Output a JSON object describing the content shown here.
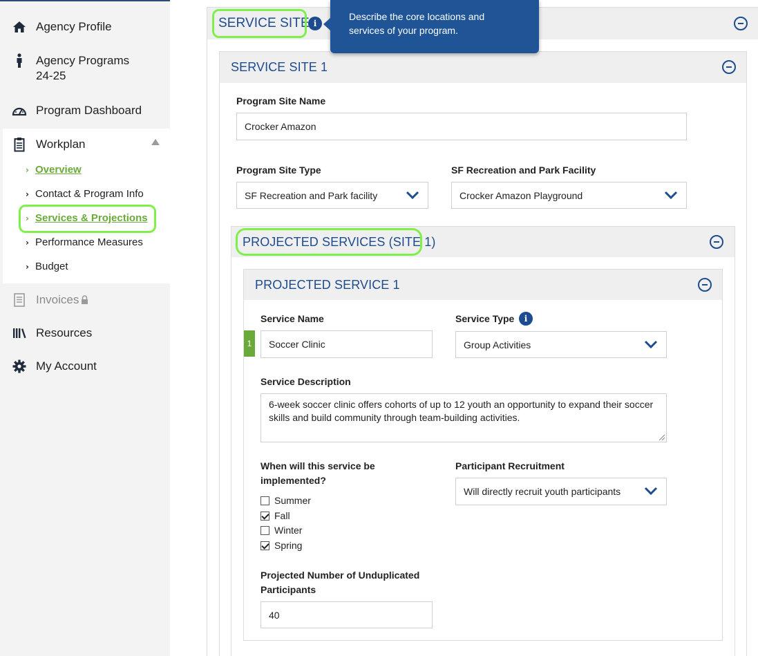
{
  "sidebar": {
    "items": [
      {
        "label": "Agency Profile",
        "icon": "home-icon"
      },
      {
        "label": "Agency Programs\n24-25",
        "icon": "person-icon"
      },
      {
        "label": "Program Dashboard",
        "icon": "dashboard-gauge-icon"
      },
      {
        "label": "Workplan",
        "icon": "clipboard-icon"
      },
      {
        "label": "Invoices",
        "icon": "document-icon"
      },
      {
        "label": "Resources",
        "icon": "library-icon"
      },
      {
        "label": "My Account",
        "icon": "gear-icon"
      }
    ],
    "workplan_sub": [
      {
        "label": "Overview"
      },
      {
        "label": "Contact & Program Info"
      },
      {
        "label": "Services & Projections"
      },
      {
        "label": "Performance Measures"
      },
      {
        "label": "Budget"
      }
    ]
  },
  "service_sites": {
    "title": "SERVICE SITES",
    "tooltip": "Describe the core locations and services of your program."
  },
  "service_site_1": {
    "title": "SERVICE SITE 1",
    "site_name_label": "Program Site Name",
    "site_name_value": "Crocker Amazon",
    "site_type_label": "Program Site Type",
    "site_type_value": "SF Recreation and Park facility",
    "facility_label": "SF Recreation and Park Facility",
    "facility_value": "Crocker Amazon Playground"
  },
  "projected_services": {
    "title": "PROJECTED SERVICES (SITE 1)"
  },
  "projected_service_1": {
    "title": "PROJECTED SERVICE 1",
    "badge": "1",
    "service_name_label": "Service Name",
    "service_name_value": "Soccer Clinic",
    "service_type_label": "Service Type",
    "service_type_value": "Group Activities",
    "description_label": "Service Description",
    "description_value": "6-week soccer clinic offers cohorts of up to 12 youth an opportunity to expand their soccer skills and build community through team-building activities.",
    "when_label": "When will this service be implemented?",
    "seasons": [
      {
        "label": "Summer",
        "checked": false
      },
      {
        "label": "Fall",
        "checked": true
      },
      {
        "label": "Winter",
        "checked": false
      },
      {
        "label": "Spring",
        "checked": true
      }
    ],
    "recruitment_label": "Participant Recruitment",
    "recruitment_value": "Will directly recruit youth participants",
    "participants_label": "Projected Number of Unduplicated Participants",
    "participants_value": "40"
  },
  "colors": {
    "accent_blue": "#1d4b8f",
    "active_green": "#6aaa3a",
    "highlight_ring": "#7ff04a",
    "tooltip_bg": "#1f5597"
  }
}
